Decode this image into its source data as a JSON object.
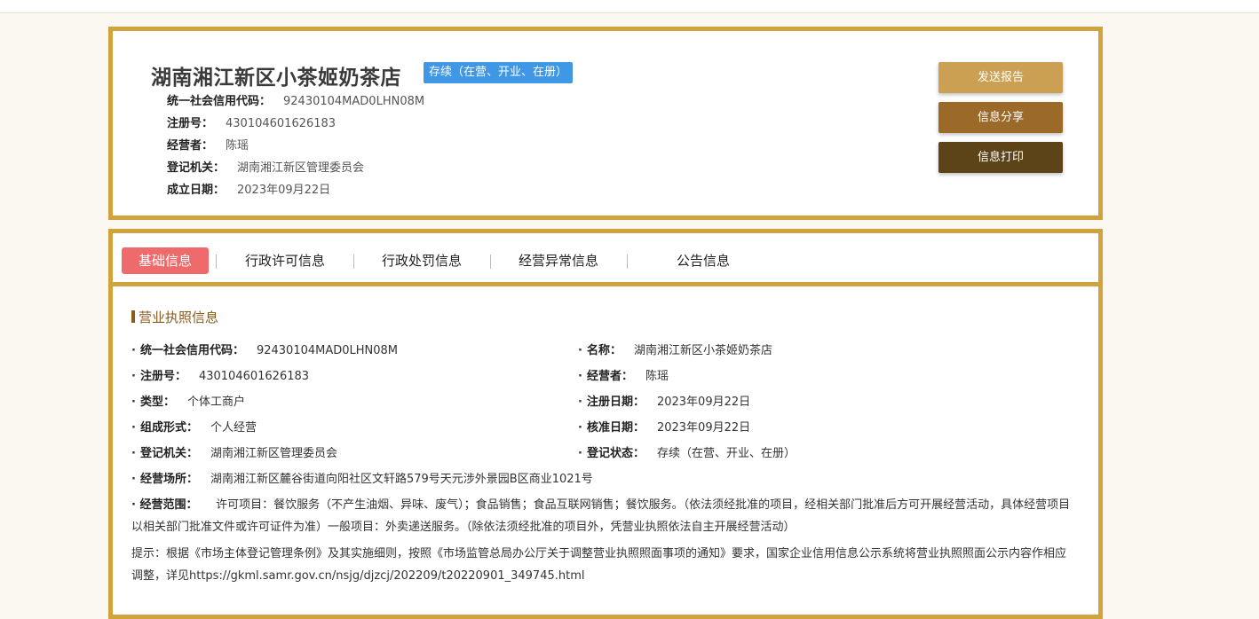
{
  "header": {
    "company_name": "湖南湘江新区小茶姬奶茶店",
    "status": "存续（在营、开业、在册）",
    "rows": [
      {
        "label": "统一社会信用代码：",
        "value": "92430104MAD0LHN08M"
      },
      {
        "label": "注册号：",
        "value": "430104601626183"
      },
      {
        "label": "经营者：",
        "value": "陈瑶"
      },
      {
        "label": "登记机关：",
        "value": "湖南湘江新区管理委员会"
      },
      {
        "label": "成立日期：",
        "value": "2023年09月22日"
      }
    ],
    "buttons": {
      "send_report": "发送报告",
      "share": "信息分享",
      "print": "信息打印"
    },
    "button_colors": {
      "send_report": "#cca052",
      "share": "#9b6a28",
      "print": "#5c4418"
    }
  },
  "tabs": [
    "基础信息",
    "行政许可信息",
    "行政处罚信息",
    "经营异常信息",
    "公告信息"
  ],
  "section": {
    "title": "营业执照信息",
    "left": [
      {
        "label": "统一社会信用代码：",
        "value": "92430104MAD0LHN08M"
      },
      {
        "label": "注册号：",
        "value": "430104601626183"
      },
      {
        "label": "类型：",
        "value": "个体工商户"
      },
      {
        "label": "组成形式：",
        "value": "个人经营"
      },
      {
        "label": "登记机关：",
        "value": "湖南湘江新区管理委员会"
      },
      {
        "label": "经营场所：",
        "value": "湖南湘江新区麓谷街道向阳社区文轩路579号天元涉外景园B区商业1021号"
      }
    ],
    "right": [
      {
        "label": "名称：",
        "value": "湖南湘江新区小茶姬奶茶店"
      },
      {
        "label": "经营者：",
        "value": "陈瑶"
      },
      {
        "label": "注册日期：",
        "value": "2023年09月22日"
      },
      {
        "label": "核准日期：",
        "value": "2023年09月22日"
      },
      {
        "label": "登记状态：",
        "value": "存续（在营、开业、在册）"
      }
    ],
    "scope_label": "经营范围：",
    "scope_value": "许可项目：餐饮服务（不产生油烟、异味、废气）；食品销售；食品互联网销售；餐饮服务。（依法须经批准的项目，经相关部门批准后方可开展经营活动，具体经营项目以相关部门批准文件或许可证件为准）一般项目：外卖递送服务。（除依法须经批准的项目外，凭营业执照依法自主开展经营活动）",
    "notice": "提示：根据《市场主体登记管理条例》及其实施细则，按照《市场监管总局办公厅关于调整营业执照照面事项的通知》要求，国家企业信用信息公示系统将营业执照照面公示内容作相应调整，详见https://gkml.samr.gov.cn/nsjg/djzcj/202209/t20220901_349745.html"
  },
  "colors": {
    "border": "#d0a33f",
    "active_tab": "#ef6b6b",
    "badge": "#3f97e6",
    "section_title": "#8a5a1e"
  }
}
